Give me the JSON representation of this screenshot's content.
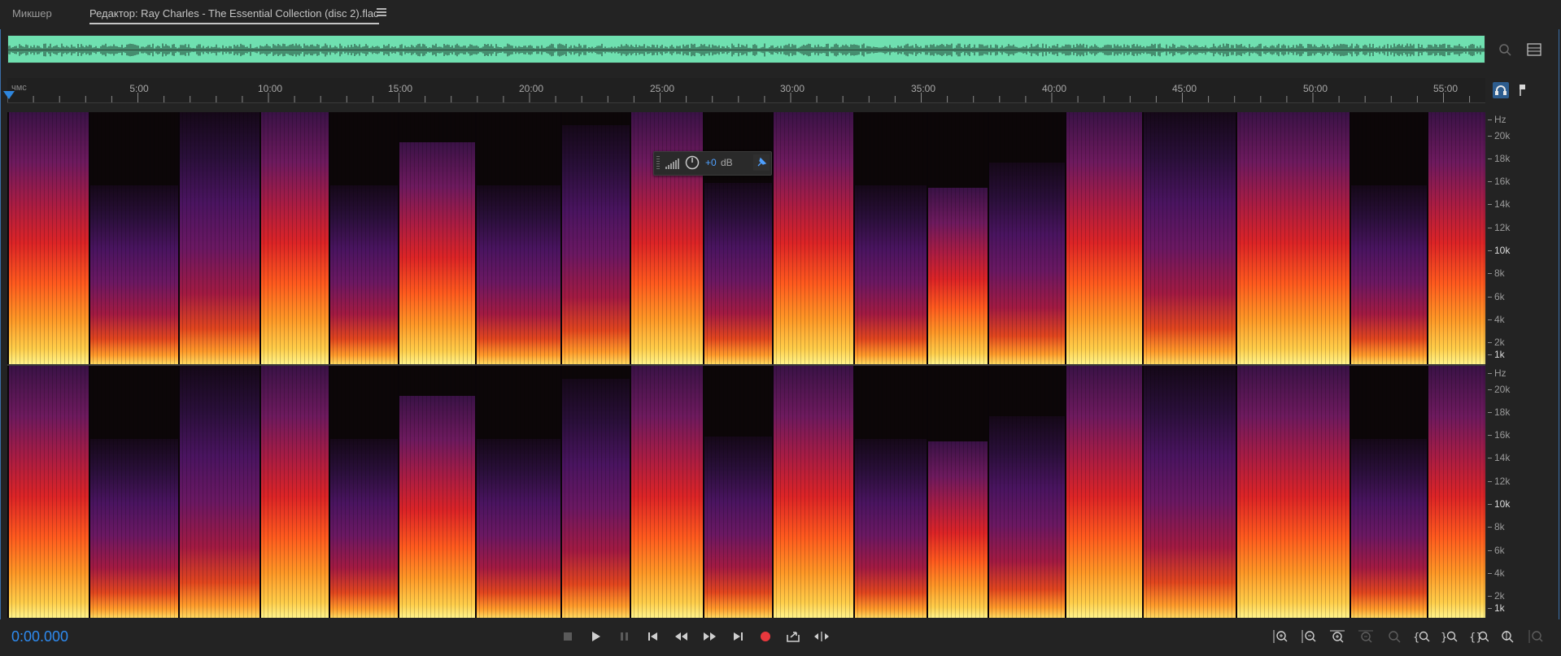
{
  "tabs": {
    "mixer": "Микшер",
    "editor": "Редактор: Ray Charles - The Essential Collection (disc 2).flac"
  },
  "ruler": {
    "unit": "чмс",
    "labels": [
      "5:00",
      "10:00",
      "15:00",
      "20:00",
      "25:00",
      "30:00",
      "35:00",
      "40:00",
      "45:00",
      "50:00",
      "55:00"
    ]
  },
  "hz_scale": {
    "unit": "Hz",
    "ticks": [
      "20k",
      "18k",
      "16k",
      "14k",
      "12k",
      "10k",
      "8k",
      "6k",
      "4k",
      "2k",
      "1k"
    ]
  },
  "hud": {
    "gain_value": "+0",
    "gain_unit": "dB"
  },
  "transport": {
    "time": "0:00.000"
  },
  "colors": {
    "overview_waveform_bg": "#6fe0b0",
    "accent_blue": "#2e8bf0",
    "record_red": "#e8383d"
  }
}
